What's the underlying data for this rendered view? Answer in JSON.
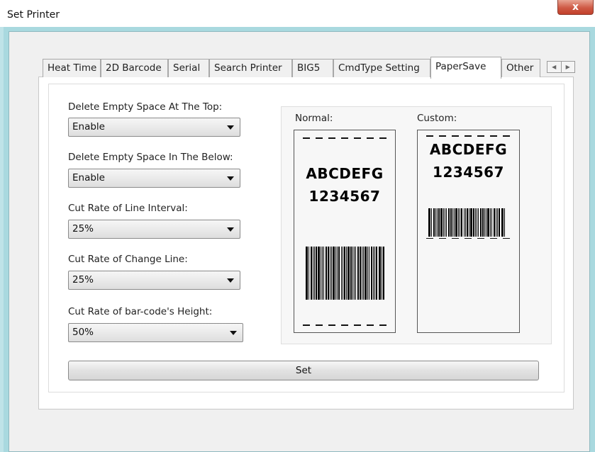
{
  "window": {
    "title": "Set Printer",
    "close_glyph": "x"
  },
  "tabs": [
    {
      "label": "Heat Time"
    },
    {
      "label": "2D Barcode"
    },
    {
      "label": "Serial"
    },
    {
      "label": "Search Printer"
    },
    {
      "label": "BIG5"
    },
    {
      "label": "CmdType Setting"
    },
    {
      "label": "PaperSave",
      "active": true
    },
    {
      "label": "Other"
    }
  ],
  "tab_scroll": {
    "left_icon": "arrow-left-icon",
    "right_icon": "arrow-right-icon"
  },
  "settings": {
    "top_label": "Delete Empty Space At The Top:",
    "top_value": "Enable",
    "below_label": "Delete Empty Space In The Below:",
    "below_value": "Enable",
    "line_interval_label": "Cut Rate of Line Interval:",
    "line_interval_value": "25%",
    "change_line_label": "Cut Rate of Change Line:",
    "change_line_value": "25%",
    "barcode_height_label": "Cut Rate of bar-code's Height:",
    "barcode_height_value": "50%"
  },
  "preview": {
    "normal_label": "Normal:",
    "custom_label": "Custom:",
    "sample_text": "ABCDEFG",
    "sample_digits": "1234567"
  },
  "set_button": "Set",
  "colors": {
    "frame": "#a9d9df",
    "close": "#cf5a45"
  }
}
